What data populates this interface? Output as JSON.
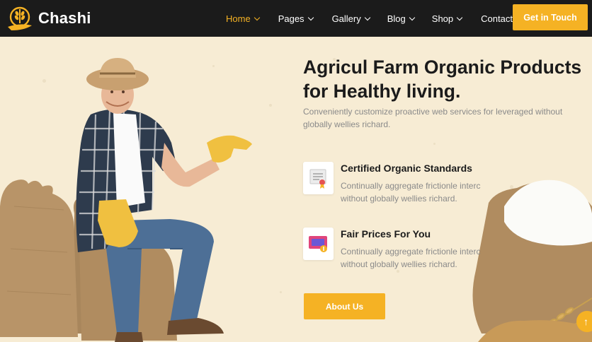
{
  "brand": {
    "name": "Chashi"
  },
  "nav": {
    "items": [
      {
        "label": "Home",
        "active": true,
        "has_dropdown": true
      },
      {
        "label": "Pages",
        "active": false,
        "has_dropdown": true
      },
      {
        "label": "Gallery",
        "active": false,
        "has_dropdown": true
      },
      {
        "label": "Blog",
        "active": false,
        "has_dropdown": true
      },
      {
        "label": "Shop",
        "active": false,
        "has_dropdown": true
      },
      {
        "label": "Contact",
        "active": false,
        "has_dropdown": false
      }
    ],
    "cta_label": "Get in Touch"
  },
  "hero": {
    "headline": "Agricul Farm Organic Products for Healthy living.",
    "subtext": "Conveniently customize proactive web services for leveraged without globally wellies richard.",
    "features": [
      {
        "title": "Certified Organic Standards",
        "description": "Continually aggregate frictionle interc without globally wellies richard.",
        "icon": "certificate-icon"
      },
      {
        "title": "Fair Prices For You",
        "description": "Continually aggregate frictionle interc without globally wellies richard.",
        "icon": "price-tag-icon"
      }
    ],
    "button_label": "About Us"
  },
  "scroll_top_icon": "arrow-up-icon",
  "colors": {
    "accent": "#f5b224",
    "nav_bg": "#1b1b1b",
    "hero_bg": "#f7ecd4",
    "text_dark": "#1b1b1b",
    "text_muted": "#8a8a8a"
  }
}
